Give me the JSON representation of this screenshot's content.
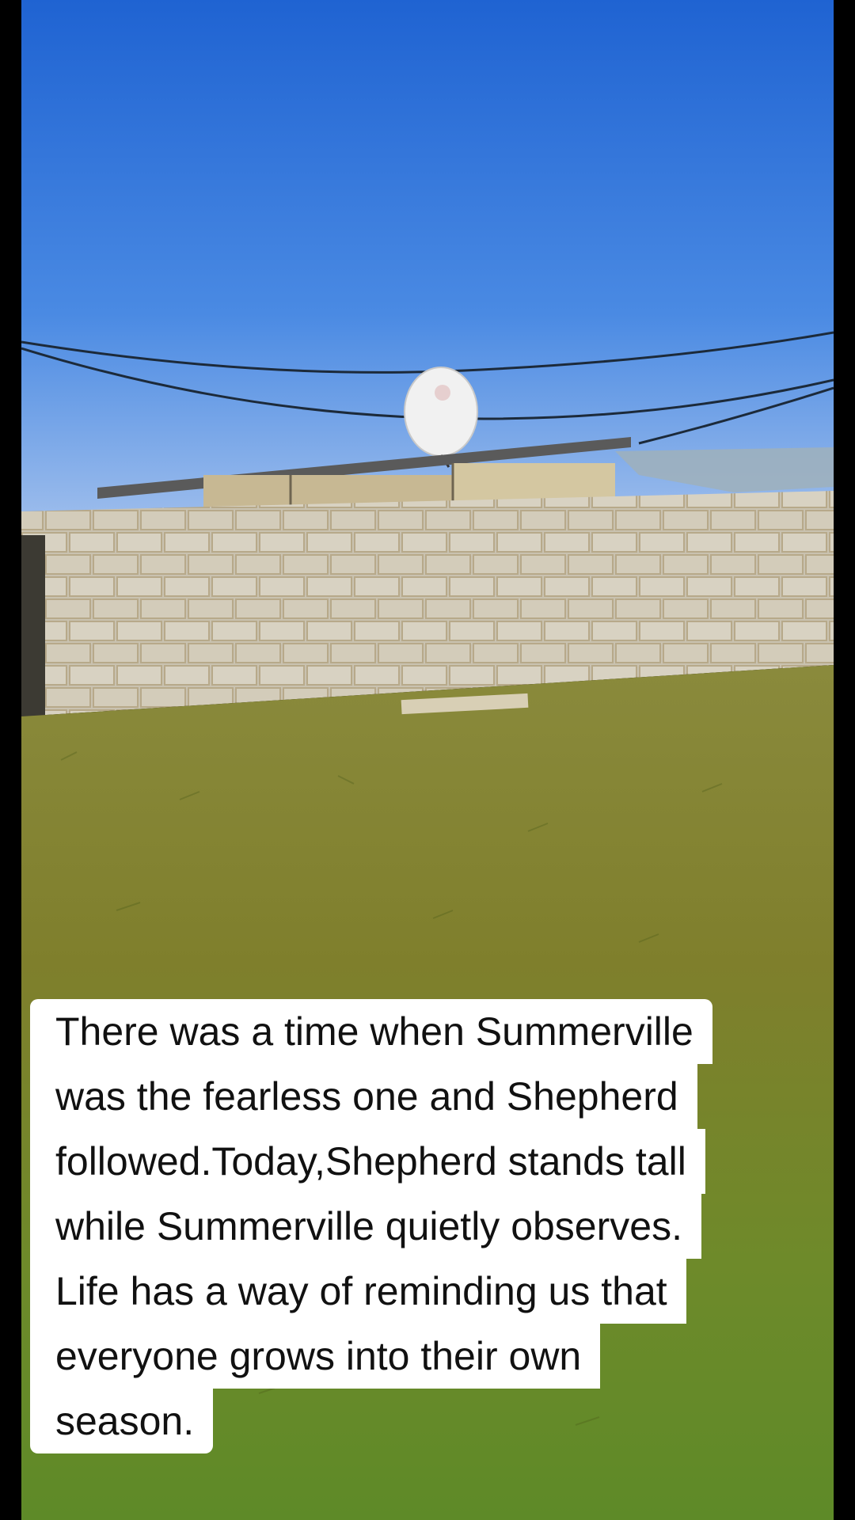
{
  "caption": {
    "lines": [
      "There was a time when Summerville",
      "was the fearless one and Shepherd",
      "followed.Today,Shepherd stands tall",
      "while Summerville quietly observes.",
      "Life has a way of reminding us that",
      "everyone grows into their own",
      "season."
    ]
  },
  "colors": {
    "sky_top": "#2a6fd6",
    "sky_bottom": "#8fb6ee",
    "wall": "#cfc8b8",
    "grass": "#7a8a2e",
    "caption_bg": "#ffffff",
    "caption_text": "#111111"
  }
}
